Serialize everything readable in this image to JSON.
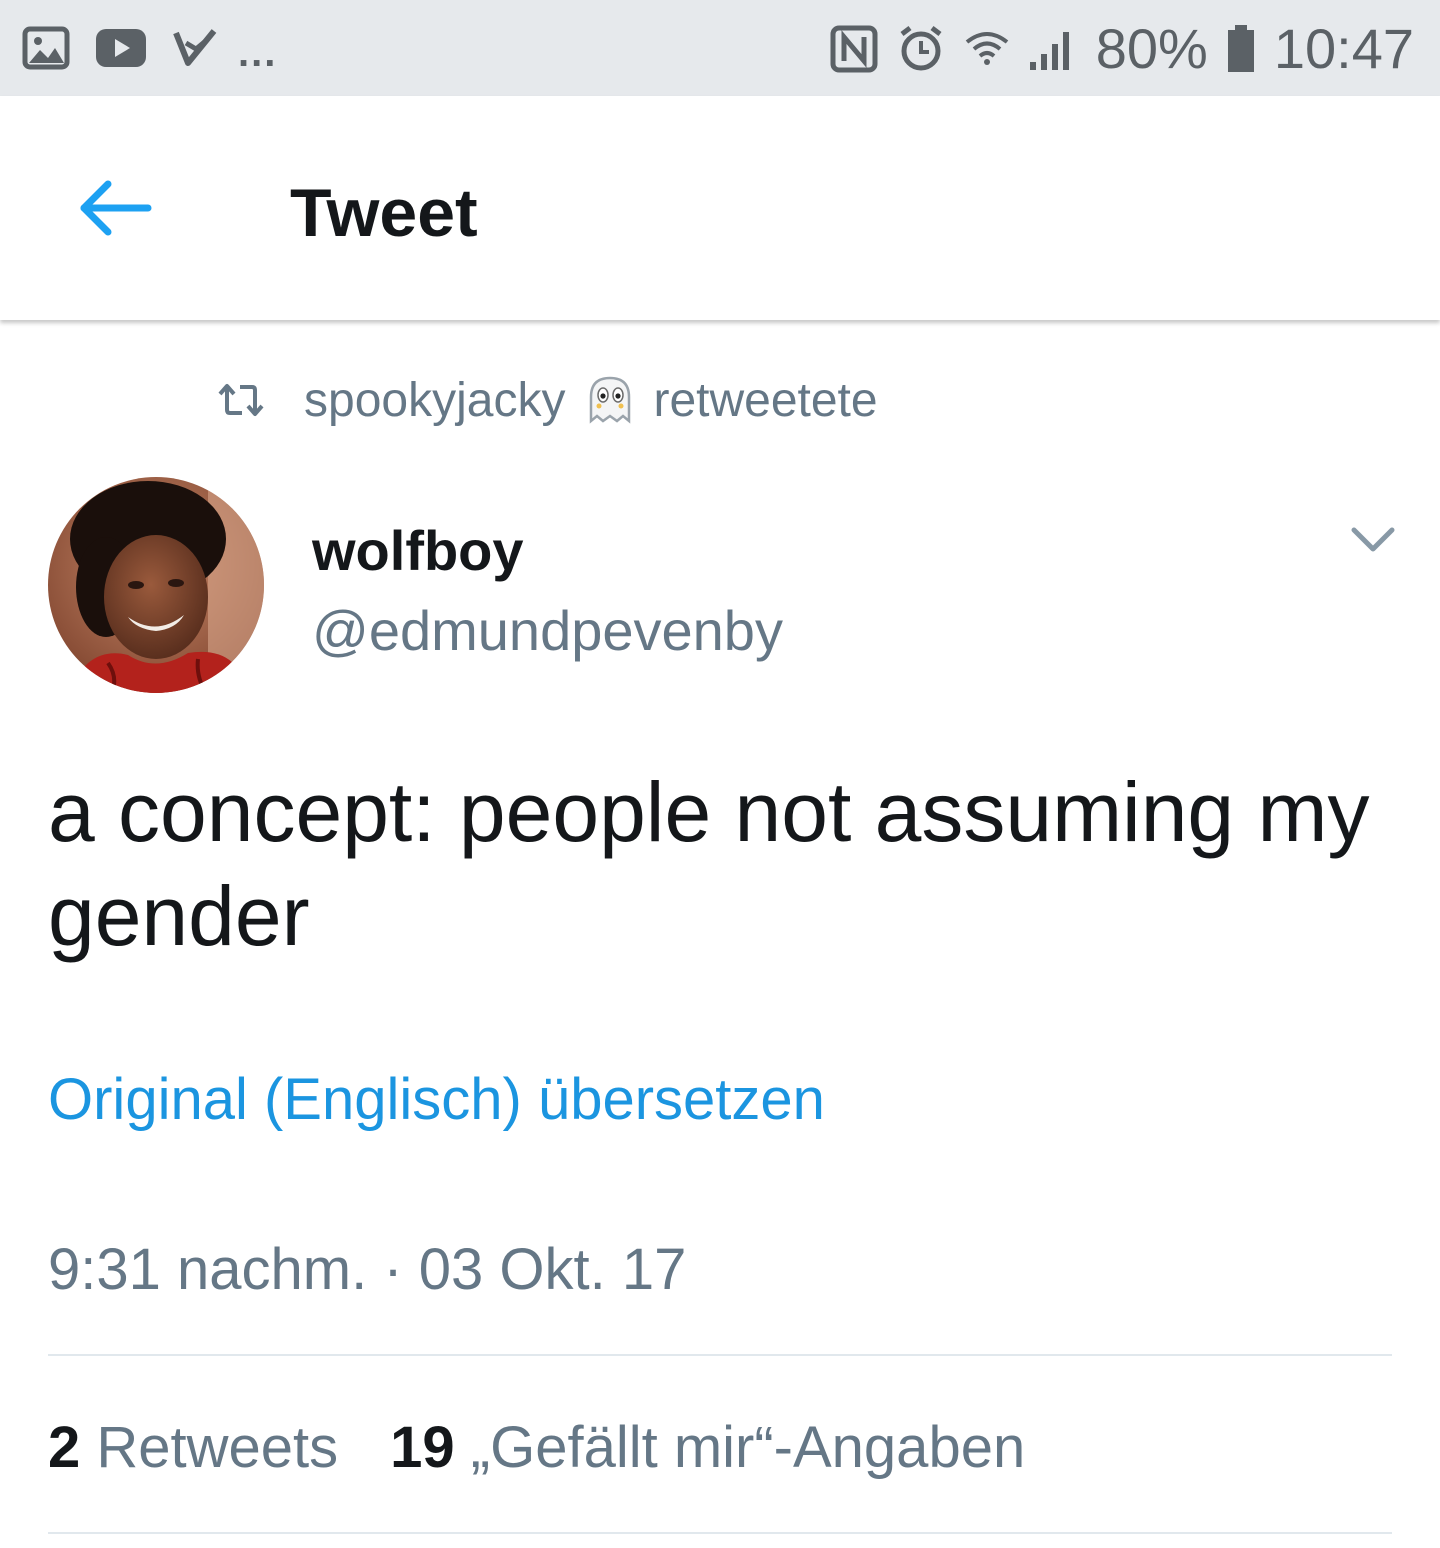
{
  "status_bar": {
    "left_icons": [
      "gallery-icon",
      "youtube-icon",
      "task-check-icon"
    ],
    "overflow": "...",
    "right_icons": [
      "nfc-icon",
      "alarm-icon",
      "wifi-icon",
      "signal-icon",
      "battery-icon"
    ],
    "battery": "80%",
    "time": "10:47"
  },
  "header": {
    "back_icon": "arrow-left-icon",
    "title": "Tweet",
    "accent_color": "#1da1f2"
  },
  "retweet": {
    "icon": "retweet-icon",
    "user": "spookyjacky",
    "emoji": "ghost-emoji-icon",
    "action": "retweetete"
  },
  "author": {
    "name": "wolfboy",
    "handle": "@edmundpevenby",
    "menu_icon": "chevron-down-icon"
  },
  "tweet": {
    "text": "a concept: people not assuming my gender",
    "translate_link": "Original (Englisch) übersetzen",
    "timestamp": "9:31 nachm. · 03 Okt. 17"
  },
  "stats": {
    "retweets_count": "2",
    "retweets_label": " Retweets",
    "likes_count": "19",
    "likes_label": " „Gefällt mir“-Angaben"
  }
}
